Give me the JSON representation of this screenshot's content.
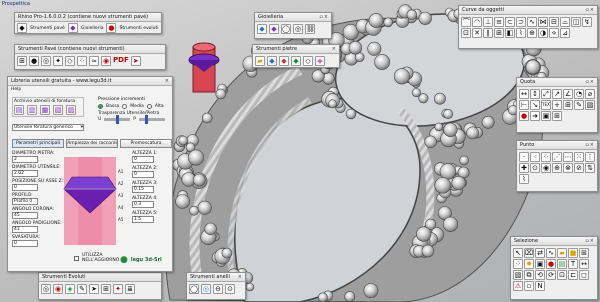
{
  "viewport": {
    "title": "Prospettica"
  },
  "rhino_panel": {
    "title": "Rhino Pro-1.6.0.0.2 (contiene nuovi strumenti pavé)",
    "buttons": [
      "Strumenti pavé",
      "Gioielleria",
      "Strumenti evoluti"
    ]
  },
  "strumenti_pave_panel": {
    "title": "Strumenti Pavé (contiene nuovi strumenti)",
    "pdf_label": "PDF"
  },
  "gioielleria_panel": {
    "title": "Gioielleria"
  },
  "strumenti_pietre_panel": {
    "title": "Strumenti pietre"
  },
  "curve_panel": {
    "title": "Curve da oggetti"
  },
  "quota_panel": {
    "title": "Quota",
    "text_label": "TEXT"
  },
  "punto_panel": {
    "title": "Punto"
  },
  "selezione_panel": {
    "title": "Selezione"
  },
  "evoluti_panel": {
    "title": "Strumenti Evoluti"
  },
  "anelli_panel": {
    "title": "Strumenti anelli"
  },
  "library_panel": {
    "title": "Libreria utensili gratuita - www.legu3d.it",
    "help": "Help",
    "archive_label": "Archivio utensili di foratura",
    "pressione_label": "Pressione incrementi",
    "radio_options": [
      "Bassa",
      "Media",
      "Alta"
    ],
    "trasparenza_label": "Trasparenza Utensile/Pietra",
    "slider_u": "U",
    "slider_p": "P",
    "dropdown_value": "Utensile foratura generico",
    "tabs": [
      "Parametri principali",
      "Ampiezza dei raccordi",
      "Premescatura"
    ],
    "left_fields": [
      {
        "label": "DIAMETRO PIETRA:",
        "value": "2"
      },
      {
        "label": "DIAMETRO UTENSILE:",
        "value": "2.02"
      },
      {
        "label": "POSIZIONE SU ASSE Z:",
        "value": "0"
      },
      {
        "label": "PROFILO:",
        "value": "Profilo 0"
      },
      {
        "label": "ANGOLO CORONA:",
        "value": "45"
      },
      {
        "label": "ANGOLO PADIGLIONE:",
        "value": "41"
      },
      {
        "label": "SVASATURA:",
        "value": "0"
      }
    ],
    "right_fields": [
      {
        "label": "ALTEZZA 1:",
        "value": "0"
      },
      {
        "label": "ALTEZZA 2:",
        "value": "0"
      },
      {
        "label": "ALTEZZA 3:",
        "value": "0.15"
      },
      {
        "label": "ALTEZZA 4:",
        "value": "0.3"
      },
      {
        "label": "ALTEZZA 5:",
        "value": "1.5"
      }
    ],
    "diagram_labels": [
      "A1",
      "A2",
      "A3",
      "A4",
      "A5"
    ],
    "checkbox_label": "UTILIZZA NELL'AGGIORNO",
    "logo_text": "legu 3d-Srl"
  },
  "colors": {
    "accent": "#0a2a7a",
    "gem": "#6a1fb0",
    "pink": "#f2a0b8"
  }
}
